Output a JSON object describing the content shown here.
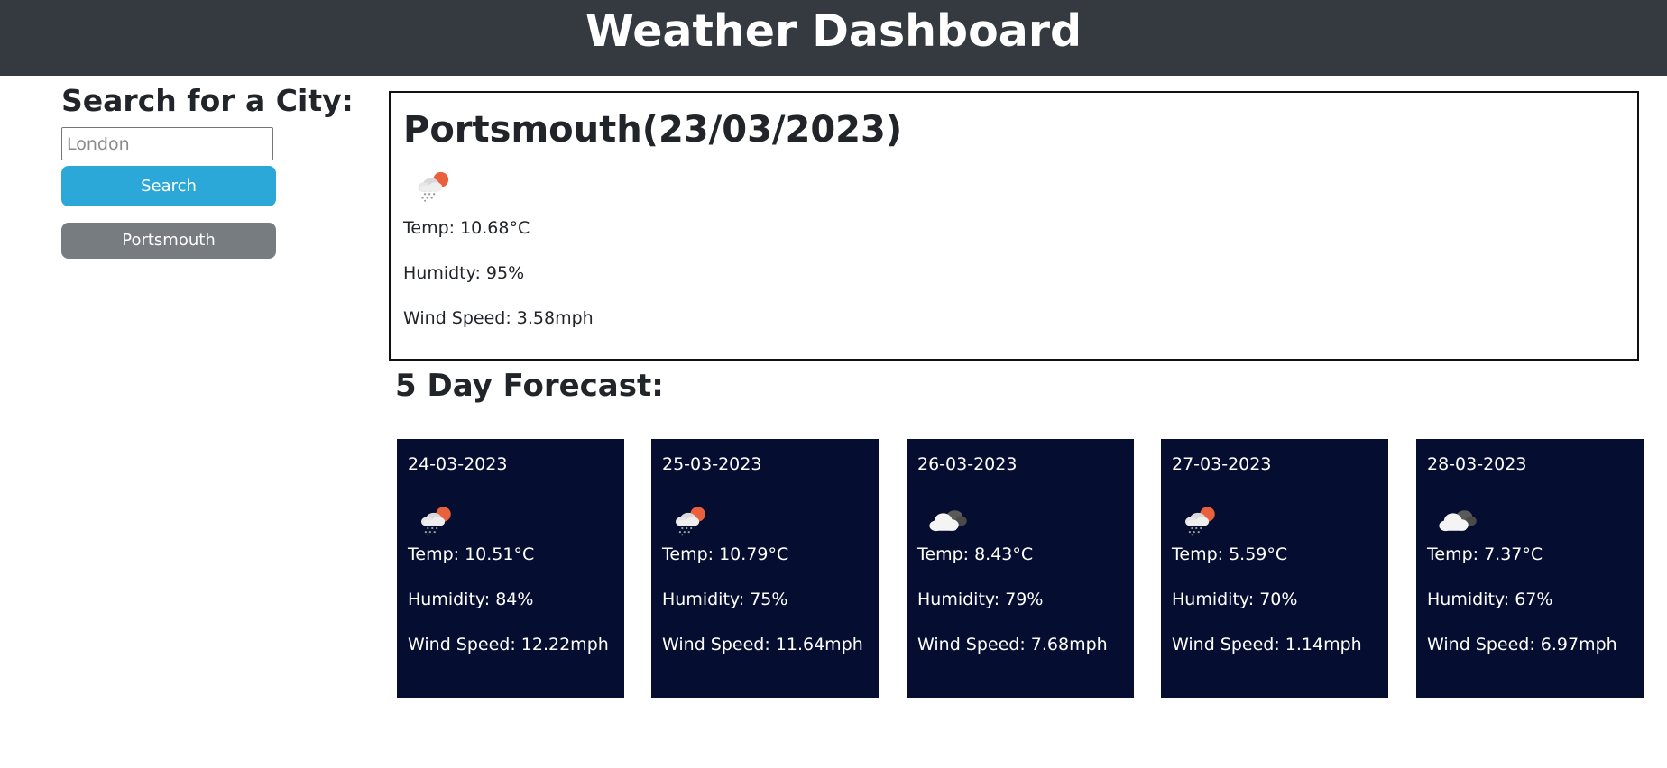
{
  "header": {
    "title": "Weather Dashboard"
  },
  "search": {
    "heading": "Search for a City:",
    "placeholder": "London",
    "button_label": "Search",
    "history": [
      "Portsmouth"
    ]
  },
  "current": {
    "title": "Portsmouth(23/03/2023)",
    "icon": "light-rain-sun-icon",
    "temp": "Temp: 10.68°C",
    "humidity": "Humidty: 95%",
    "wind": "Wind Speed: 3.58mph"
  },
  "forecast": {
    "heading": "5 Day Forecast:",
    "days": [
      {
        "date": "24-03-2023",
        "icon": "light-rain-sun-icon",
        "temp": "Temp: 10.51°C",
        "humidity": "Humidity: 84%",
        "wind": "Wind Speed: 12.22mph"
      },
      {
        "date": "25-03-2023",
        "icon": "light-rain-sun-icon",
        "temp": "Temp: 10.79°C",
        "humidity": "Humidity: 75%",
        "wind": "Wind Speed: 11.64mph"
      },
      {
        "date": "26-03-2023",
        "icon": "broken-clouds-icon",
        "temp": "Temp: 8.43°C",
        "humidity": "Humidity: 79%",
        "wind": "Wind Speed: 7.68mph"
      },
      {
        "date": "27-03-2023",
        "icon": "light-rain-sun-icon",
        "temp": "Temp: 5.59°C",
        "humidity": "Humidity: 70%",
        "wind": "Wind Speed: 1.14mph"
      },
      {
        "date": "28-03-2023",
        "icon": "broken-clouds-icon",
        "temp": "Temp: 7.37°C",
        "humidity": "Humidity: 67%",
        "wind": "Wind Speed: 6.97mph"
      }
    ]
  },
  "colors": {
    "header_bg": "#343a40",
    "search_button": "#2ba8d8",
    "history_button": "#777c80",
    "card_bg": "#050e30"
  }
}
